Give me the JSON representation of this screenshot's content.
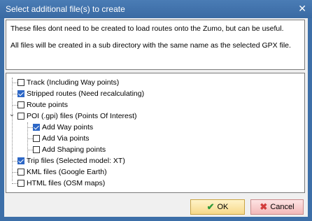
{
  "window": {
    "title": "Select additional file(s) to create",
    "close_glyph": "✕"
  },
  "info": {
    "line1": "These files dont need to be created to load routes onto the Zumo, but can be useful.",
    "line2": "All files will be created in a sub directory with the same name as the selected GPX file."
  },
  "tree": {
    "items": [
      {
        "label": "Track (Including Way points)",
        "checked": false
      },
      {
        "label": "Stripped routes (Need recalculating)",
        "checked": true
      },
      {
        "label": "Route points",
        "checked": false
      },
      {
        "label": "POI (.gpi) files (Points Of Interest)",
        "checked": false,
        "expanded": true,
        "children": [
          {
            "label": "Add Way points",
            "checked": true
          },
          {
            "label": "Add Via points",
            "checked": false
          },
          {
            "label": "Add Shaping points",
            "checked": false
          }
        ]
      },
      {
        "label": "Trip files (Selected model: XT)",
        "checked": true
      },
      {
        "label": "KML files (Google Earth)",
        "checked": false
      },
      {
        "label": "HTML files (OSM maps)",
        "checked": false
      }
    ],
    "expander_glyph": "⌄"
  },
  "buttons": {
    "ok_label": "OK",
    "cancel_label": "Cancel",
    "ok_icon": "check-icon",
    "cancel_icon": "x-icon"
  },
  "colors": {
    "titlebar": "#3d6fa8",
    "checkbox_checked": "#2d67c6"
  }
}
